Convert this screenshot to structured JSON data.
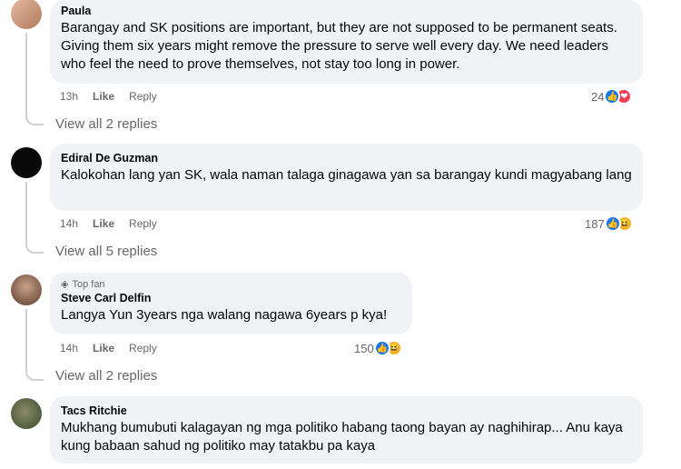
{
  "comments": [
    {
      "author": "Paula",
      "text": "Barangay and SK positions are important, but they are not supposed to be permanent seats. Giving them six years might remove the pressure to serve well every day. We need leaders who feel the need to prove themselves, not stay too long in power.",
      "time": "13h",
      "like_label": "Like",
      "reply_label": "Reply",
      "reaction_count": "24",
      "reactions": [
        "like",
        "heart"
      ],
      "view_replies": "View all 2 replies"
    },
    {
      "author": "Ediral De Guzman",
      "text": "Kalokohan lang yan SK, wala naman talaga ginagawa yan sa barangay kundi magyabang lang",
      "time": "14h",
      "like_label": "Like",
      "reply_label": "Reply",
      "reaction_count": "187",
      "reactions": [
        "like",
        "haha"
      ],
      "view_replies": "View all 5 replies"
    },
    {
      "badge": "Top fan",
      "author": "Steve Carl Delfin",
      "text": "Langya Yun 3years nga walang nagawa 6years p kya!",
      "time": "14h",
      "like_label": "Like",
      "reply_label": "Reply",
      "reaction_count": "150",
      "reactions": [
        "like",
        "haha"
      ],
      "view_replies": "View all 2 replies"
    },
    {
      "author": "Tacs Ritchie",
      "text": "Mukhang bumubuti kalagayan ng mga politiko habang taong bayan ay naghihirap... Anu kaya kung babaan sahud ng politiko may tatakbu pa kaya"
    }
  ],
  "colors": {
    "bubble": "#f0f2f5",
    "like_blue": "#1877f2",
    "heart_red": "#f33e58",
    "haha_yellow": "#f7b125",
    "meta_gray": "#65676b"
  }
}
